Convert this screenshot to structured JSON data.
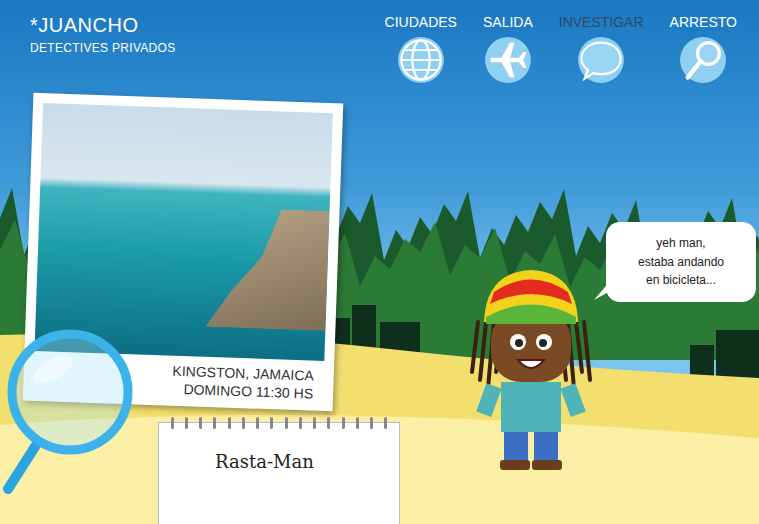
{
  "brand": {
    "logo": "*JUANCHO",
    "subtitle": "DETECTIVES PRIVADOS"
  },
  "nav": [
    {
      "label": "CIUDADES",
      "selected": false
    },
    {
      "label": "SALIDA",
      "selected": false
    },
    {
      "label": "INVESTIGAR",
      "selected": true
    },
    {
      "label": "ARRESTO",
      "selected": false
    }
  ],
  "photo": {
    "place": "KINGSTON, JAMAICA",
    "time": "DOMINGO 11:30 HS"
  },
  "witness": {
    "name": "Rasta-Man",
    "speech": [
      "yeh man,",
      "estaba andando",
      "en bicicleta..."
    ]
  }
}
